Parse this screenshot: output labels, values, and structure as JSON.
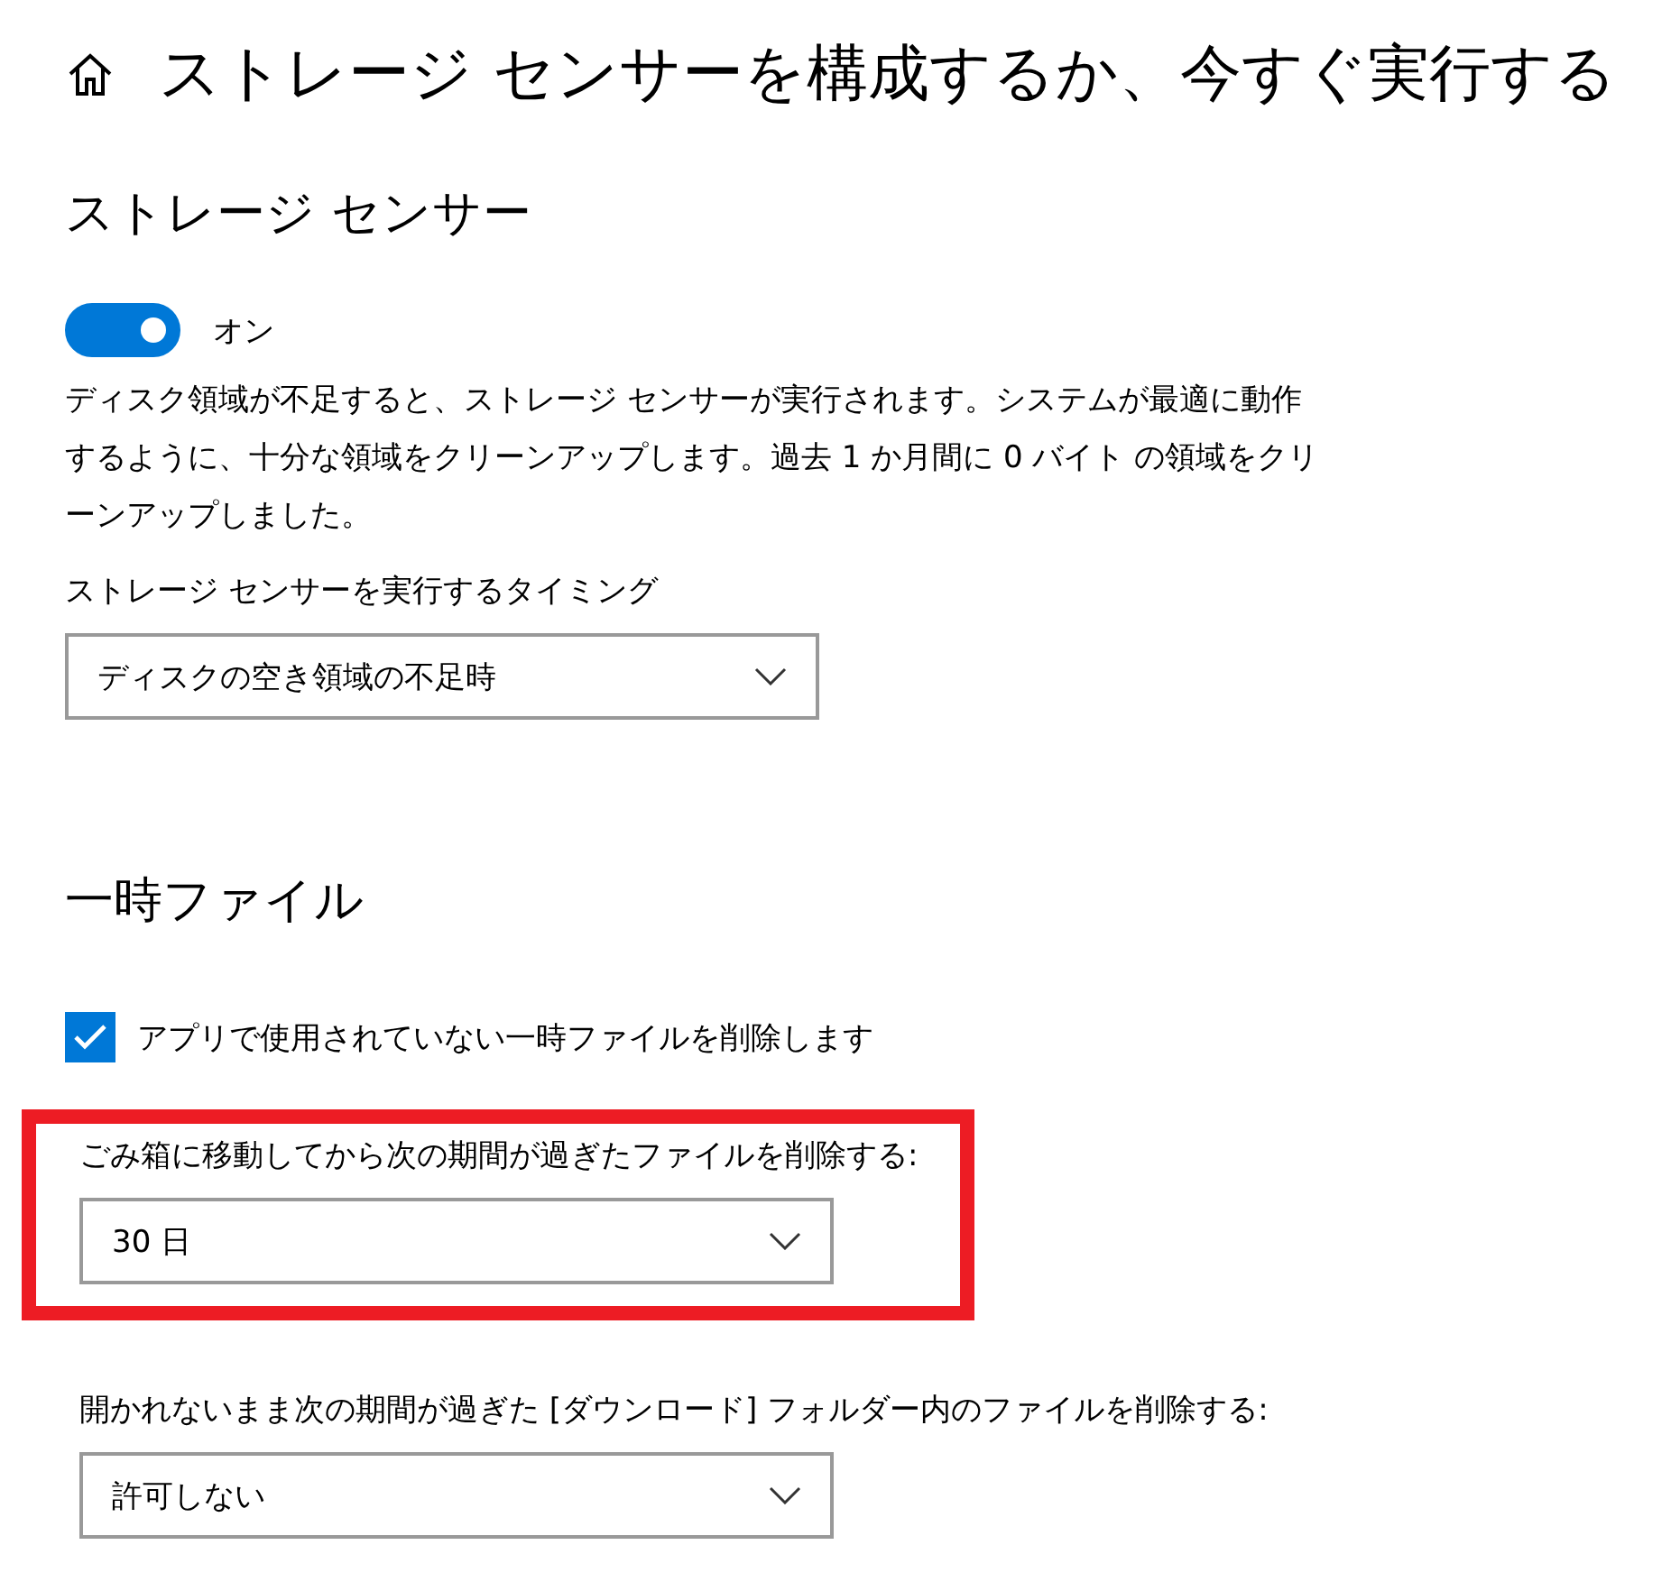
{
  "header": {
    "title": "ストレージ センサーを構成するか、今すぐ実行する"
  },
  "storage_sense": {
    "heading": "ストレージ センサー",
    "toggle": {
      "on": true,
      "label": "オン"
    },
    "description": "ディスク領域が不足すると、ストレージ センサーが実行されます。システムが最適に動作するように、十分な領域をクリーンアップします。過去 1 か月間に 0 バイト の領域をクリーンアップしました。",
    "timing": {
      "label": "ストレージ センサーを実行するタイミング",
      "value": "ディスクの空き領域の不足時"
    }
  },
  "temporary_files": {
    "heading": "一時ファイル",
    "checkbox": {
      "checked": true,
      "label": "アプリで使用されていない一時ファイルを削除します"
    },
    "dropdowns": [
      {
        "label": "ごみ箱に移動してから次の期間が過ぎたファイルを削除する:",
        "value": "30 日",
        "highlighted": true
      },
      {
        "label": "開かれないまま次の期間が過ぎた [ダウンロード] フォルダー内のファイルを削除する:",
        "value": "許可しない",
        "highlighted": false
      }
    ]
  }
}
